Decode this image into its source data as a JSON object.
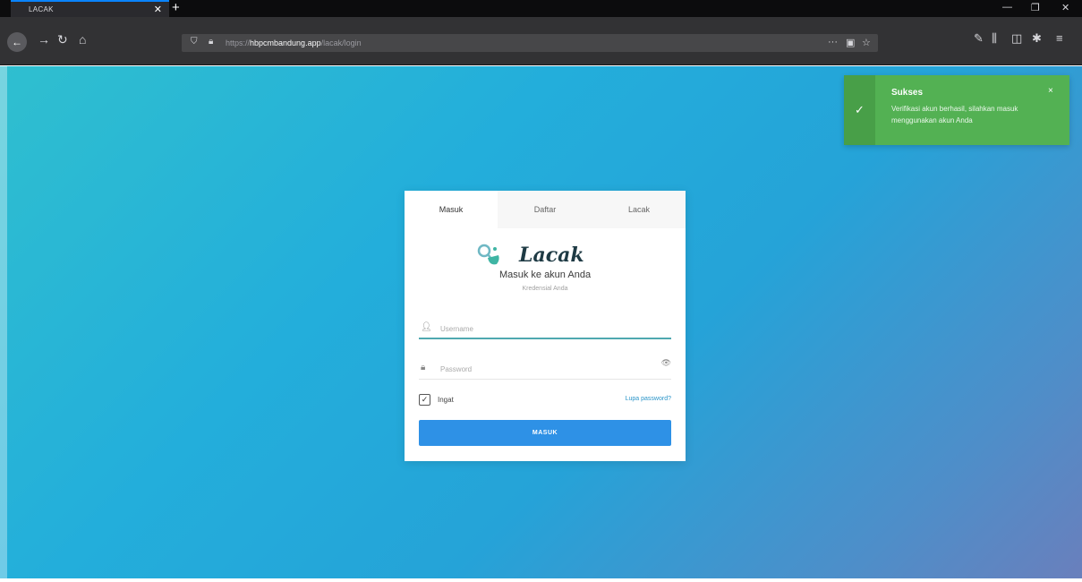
{
  "browser": {
    "tab_title": "LACAK",
    "tab_close": "✕",
    "new_tab": "+",
    "win_minimize": "—",
    "win_restore": "❐",
    "win_close": "✕",
    "url_scheme": "https://",
    "url_host": "hbpcmbandung.app",
    "url_path": "/lacak/login",
    "page_actions": "···"
  },
  "toast": {
    "title": "Sukses",
    "message": "Verifikasi akun berhasil, silahkan masuk menggunakan akun Anda",
    "icon": "check-icon",
    "close": "×",
    "color": "#53b153"
  },
  "card": {
    "tabs": [
      {
        "label": "Masuk"
      },
      {
        "label": "Daftar"
      },
      {
        "label": "Lacak"
      }
    ],
    "logo_text": "Lacak",
    "heading": "Masuk ke akun Anda",
    "subheading": "Kredensial Anda",
    "username_placeholder": "Username",
    "password_placeholder": "Password",
    "remember_label": "Ingat",
    "forgot_label": "Lupa password?",
    "submit_label": "MASUK"
  },
  "colors": {
    "accent": "#2e91e6",
    "input_focus": "#4fa8b0",
    "link": "#2b95c9"
  }
}
